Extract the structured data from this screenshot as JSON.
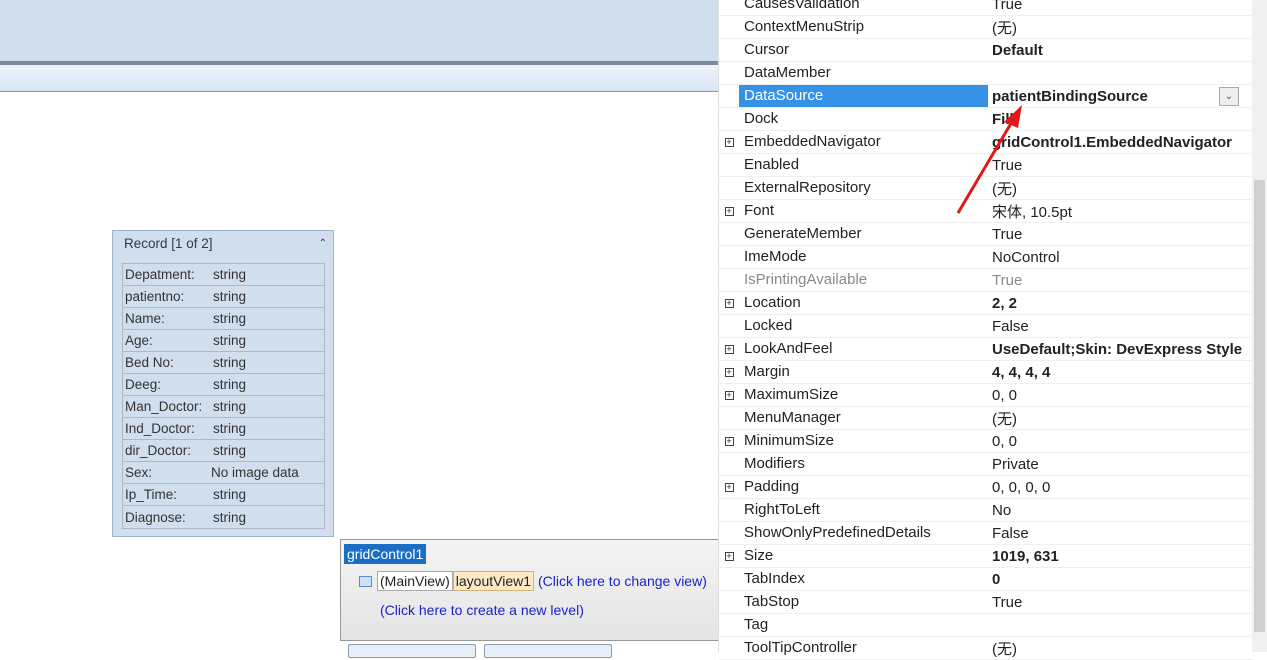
{
  "record_card": {
    "title": "Record [1 of 2]",
    "fields": [
      {
        "label": "Depatment:",
        "value": "string"
      },
      {
        "label": "patientno:",
        "value": "string"
      },
      {
        "label": "Name:",
        "value": "string"
      },
      {
        "label": "Age:",
        "value": "string"
      },
      {
        "label": "Bed No:",
        "value": "string"
      },
      {
        "label": "Deeg:",
        "value": "string"
      },
      {
        "label": "Man_Doctor:",
        "value": "string"
      },
      {
        "label": "Ind_Doctor:",
        "value": "string"
      },
      {
        "label": "dir_Doctor:",
        "value": "string"
      },
      {
        "label": "Sex:",
        "value": "No image data"
      },
      {
        "label": "Ip_Time:",
        "value": "string"
      },
      {
        "label": "Diagnose:",
        "value": "string"
      }
    ]
  },
  "level_designer": {
    "control": "gridControl1",
    "main_view": "(MainView)",
    "view_name": "layoutView1",
    "change_view": "(Click here to change view)",
    "new_level": "(Click here to create a new level)"
  },
  "properties": [
    {
      "name": "CausesValidation",
      "value": "True"
    },
    {
      "name": "ContextMenuStrip",
      "value": "(无)"
    },
    {
      "name": "Cursor",
      "value": "Default",
      "bold": true
    },
    {
      "name": "DataMember",
      "value": ""
    },
    {
      "name": "DataSource",
      "value": "patientBindingSource",
      "bold": true,
      "selected": true
    },
    {
      "name": "Dock",
      "value": "Fill",
      "bold": true
    },
    {
      "name": "EmbeddedNavigator",
      "value": "gridControl1.EmbeddedNavigator",
      "bold": true,
      "expand": true
    },
    {
      "name": "Enabled",
      "value": "True"
    },
    {
      "name": "ExternalRepository",
      "value": "(无)"
    },
    {
      "name": "Font",
      "value": "宋体, 10.5pt",
      "expand": true
    },
    {
      "name": "GenerateMember",
      "value": "True"
    },
    {
      "name": "ImeMode",
      "value": "NoControl"
    },
    {
      "name": "IsPrintingAvailable",
      "value": "True",
      "disabled": true
    },
    {
      "name": "Location",
      "value": "2, 2",
      "bold": true,
      "expand": true
    },
    {
      "name": "Locked",
      "value": "False"
    },
    {
      "name": "LookAndFeel",
      "value": "UseDefault;Skin: DevExpress Style",
      "bold": true,
      "expand": true
    },
    {
      "name": "Margin",
      "value": "4, 4, 4, 4",
      "bold": true,
      "expand": true
    },
    {
      "name": "MaximumSize",
      "value": "0, 0",
      "expand": true
    },
    {
      "name": "MenuManager",
      "value": "(无)"
    },
    {
      "name": "MinimumSize",
      "value": "0, 0",
      "expand": true
    },
    {
      "name": "Modifiers",
      "value": "Private"
    },
    {
      "name": "Padding",
      "value": "0, 0, 0, 0",
      "expand": true
    },
    {
      "name": "RightToLeft",
      "value": "No"
    },
    {
      "name": "ShowOnlyPredefinedDetails",
      "value": "False"
    },
    {
      "name": "Size",
      "value": "1019, 631",
      "bold": true,
      "expand": true
    },
    {
      "name": "TabIndex",
      "value": "0",
      "bold": true
    },
    {
      "name": "TabStop",
      "value": "True"
    },
    {
      "name": "Tag",
      "value": ""
    },
    {
      "name": "ToolTipController",
      "value": "(无)"
    }
  ]
}
